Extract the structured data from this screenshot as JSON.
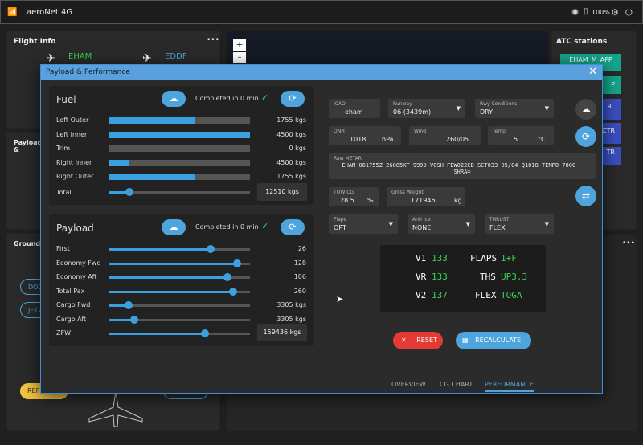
{
  "titlebar": {
    "title": "aeroNet 4G",
    "battery": "100%",
    "minimize": "—",
    "maximize": "☐",
    "close": "✕"
  },
  "flight_info": {
    "title": "Flight Info",
    "menu": "•••",
    "origin": "EHAM",
    "destination": "EDDF"
  },
  "left_panels": {
    "payload_stub": "Payload &",
    "ground_stub": "Ground H",
    "doc_btn": "DOC",
    "jetw_btn": "JETW",
    "refuel_btn": "REF"
  },
  "map": {
    "zoom_in": "+",
    "zoom_out": "–"
  },
  "atc": {
    "title": "ATC stations",
    "stations": [
      "EHAM_M_APP",
      "P",
      "R",
      "CTR",
      "TR"
    ]
  },
  "modal": {
    "title": "Payload & Performance",
    "close": "✕",
    "fuel": {
      "title": "Fuel",
      "completed": "Completed in 0 min",
      "rows": [
        {
          "label": "Left Outer",
          "value": "1755 kgs",
          "fill": 0.61
        },
        {
          "label": "Left Inner",
          "value": "4500 kgs",
          "fill": 1.0
        },
        {
          "label": "Trim",
          "value": "0 kgs",
          "fill": 0.0
        },
        {
          "label": "Right Inner",
          "value": "4500 kgs",
          "fill": 0.14
        },
        {
          "label": "Right Outer",
          "value": "1755 kgs",
          "fill": 0.61
        }
      ],
      "total_label": "Total",
      "total_value": "12510 kgs",
      "total_level": 0.15
    },
    "payload": {
      "title": "Payload",
      "completed": "Completed in 0 min",
      "rows": [
        {
          "label": "First",
          "value": "26",
          "level": 0.72
        },
        {
          "label": "Economy Fwd",
          "value": "128",
          "level": 0.91
        },
        {
          "label": "Economy Aft",
          "value": "106",
          "level": 0.84
        },
        {
          "label": "Total Pax",
          "value": "260",
          "level": 0.88
        },
        {
          "label": "Cargo Fwd",
          "value": "3305 kgs",
          "level": 0.14
        },
        {
          "label": "Cargo Aft",
          "value": "3305 kgs",
          "level": 0.18
        }
      ],
      "zfw_label": "ZFW",
      "zfw_value": "159436 kgs",
      "zfw_level": 0.68
    },
    "perf_inputs": {
      "icao_label": "ICAO",
      "icao": "eham",
      "runway_label": "Runway",
      "runway": "06 (3439m)",
      "rwy_cond_label": "Rwy Conditions",
      "rwy_cond": "DRY",
      "qnh_label": "QNH",
      "qnh": "1018",
      "qnh_unit": "hPa",
      "wind_label": "Wind",
      "wind": "260/05",
      "temp_label": "Temp",
      "temp": "5",
      "temp_unit": "°C",
      "metar_label": "Raw METAR",
      "metar": "EHAM 061755Z 26005KT 9999 VCSH FEW022CB SCT033 05/04 Q1018 TEMPO 7000 -SHRA=",
      "towcg_label": "TOW CG",
      "towcg": "28.5",
      "towcg_unit": "%",
      "gw_label": "Gross Weight",
      "gw": "171946",
      "gw_unit": "kg",
      "flaps_label": "Flaps",
      "flaps": "OPT",
      "antiice_label": "Anti Ice",
      "antiice": "NONE",
      "thrust_label": "THRUST",
      "thrust": "FLEX"
    },
    "perf_output": {
      "v1_l": "V1",
      "v1": "133",
      "vr_l": "VR",
      "vr": "133",
      "v2_l": "V2",
      "v2": "137",
      "flaps_l": "FLAPS",
      "flaps": "1+F",
      "ths_l": "THS",
      "ths": "UP3.3",
      "flex_l": "FLEX",
      "flex": "TOGA"
    },
    "buttons": {
      "reset": "RESET",
      "recalculate": "RECALCULATE"
    },
    "tabs": [
      "OVERVIEW",
      "CG CHART",
      "PERFORMANCE"
    ]
  },
  "colors": {
    "accent": "#4ea4dc",
    "green": "#39d353",
    "reset": "#e53935"
  }
}
